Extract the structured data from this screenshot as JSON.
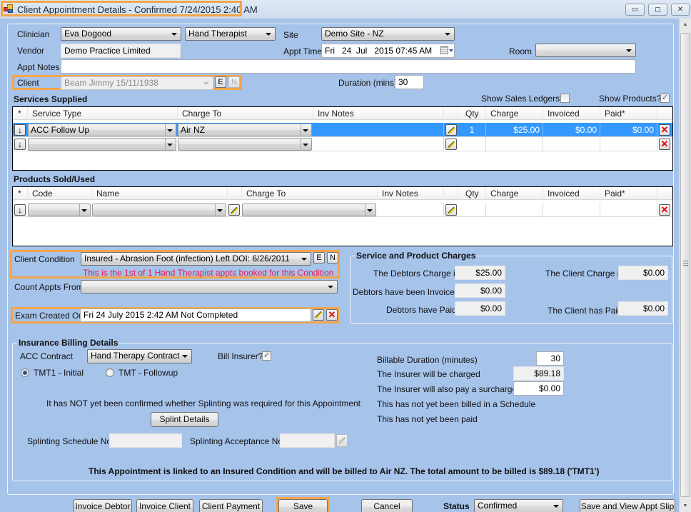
{
  "window": {
    "title": "Client Appointment Details - Confirmed 7/24/2015 2:40 AM",
    "icon": "app-window-icon",
    "controls": {
      "minimize": "▭",
      "maximize": "◻",
      "close": "✕"
    }
  },
  "appointment": {
    "clinician_label": "Clinician",
    "clinician_value": "Eva Dogood",
    "role_value": "Hand Therapist",
    "site_label": "Site",
    "site_value": "Demo Site - NZ",
    "vendor_label": "Vendor",
    "vendor_value": "Demo Practice Limited",
    "appt_time_label": "Appt Time",
    "appt_time_value": "Fri   24  Jul   2015 07:45 AM",
    "room_label": "Room",
    "room_value": "",
    "notes_label": "Appt Notes",
    "notes_value": "",
    "client_label": "Client",
    "client_value": "Beam Jimmy 15/11/1938",
    "client_edit_btn": "E",
    "client_new_btn": "N",
    "duration_label": "Duration (mins)",
    "duration_value": "30"
  },
  "services": {
    "title": "Services Supplied",
    "show_sales_ledgers_label": "Show Sales Ledgers?",
    "show_sales_ledgers_checked": false,
    "show_products_label": "Show Products?",
    "show_products_checked": true,
    "columns": [
      "*",
      "Service Type",
      "Charge To",
      "Inv Notes",
      "",
      "Qty",
      "Charge",
      "Invoiced",
      "Paid*",
      ""
    ],
    "rows": [
      {
        "service_type": "ACC Follow Up",
        "charge_to": "Air NZ",
        "inv_notes": "",
        "qty": "1",
        "charge": "$25.00",
        "invoiced": "$0.00",
        "paid": "$0.00",
        "selected": true
      },
      {
        "service_type": "",
        "charge_to": "",
        "inv_notes": "",
        "qty": "",
        "charge": "",
        "invoiced": "",
        "paid": "",
        "selected": false
      }
    ]
  },
  "products": {
    "title": "Products Sold/Used",
    "columns": [
      "*",
      "Code",
      "Name",
      "",
      "Charge To",
      "Inv Notes",
      "",
      "Qty",
      "Charge",
      "Invoiced",
      "Paid*",
      ""
    ],
    "rows": [
      {
        "code": "",
        "name": "",
        "charge_to": "",
        "inv_notes": "",
        "qty": "",
        "charge": "",
        "invoiced": "",
        "paid": ""
      }
    ]
  },
  "condition": {
    "label": "Client Condition",
    "value": "Insured -  Abrasion Foot (infection) Left DOI: 6/26/2011",
    "edit_btn": "E",
    "new_btn": "N",
    "note": "This is the 1st of 1 Hand Therapist appts booked for this Condition",
    "count_from_label": "Count Appts From",
    "count_from_value": "",
    "exam_label": "Exam Created On",
    "exam_value": "Fri 24 July 2015 2:42 AM Not Completed"
  },
  "charges": {
    "title": "Service and Product Charges",
    "debtors_charge_label": "The Debtors Charge is",
    "debtors_charge_value": "$25.00",
    "client_charge_label": "The Client Charge is",
    "client_charge_value": "$0.00",
    "debtors_invoiced_label": "Debtors have been Invoiced",
    "debtors_invoiced_value": "$0.00",
    "debtors_paid_label": "Debtors have Paid",
    "debtors_paid_value": "$0.00",
    "client_paid_label": "The Client has Paid",
    "client_paid_value": "$0.00"
  },
  "insurance": {
    "title": "Insurance Billing Details",
    "acc_contract_label": "ACC Contract",
    "acc_contract_value": "Hand Therapy Contract",
    "bill_insurer_label": "Bill Insurer?",
    "bill_insurer_checked": true,
    "radio_initial_label": "TMT1 - Initial",
    "radio_initial_selected": true,
    "radio_followup_label": "TMT - Followup",
    "radio_followup_selected": false,
    "splint_note": "It has NOT yet been confirmed whether Splinting was required for this Appointment",
    "splint_btn": "Splint Details",
    "splint_schedule_label": "Splinting Schedule No",
    "splint_schedule_value": "",
    "splint_acceptance_label": "Splinting Acceptance No",
    "splint_acceptance_value": "",
    "billable_duration_label": "Billable Duration (minutes)",
    "billable_duration_value": "30",
    "insurer_charged_label": "The Insurer will be charged",
    "insurer_charged_value": "$89.18",
    "surcharge_label": "The Insurer will also pay a surcharge of",
    "surcharge_value": "$0.00",
    "schedule_status": "This has not yet been billed in a Schedule",
    "paid_status": "This has not yet been paid",
    "summary": "This Appointment is linked to an Insured Condition and will be billed to Air NZ. The total amount to be billed is $89.18 ('TMT1')"
  },
  "footer": {
    "invoice_debtor": "Invoice Debtor",
    "invoice_client": "Invoice Client",
    "client_payment": "Client Payment",
    "save": "Save",
    "cancel": "Cancel",
    "status_label": "Status",
    "status_value": "Confirmed",
    "save_view_slip": "Save and View Appt Slip"
  },
  "colors": {
    "panel_bg": "#a6c3ea",
    "highlight": "#f5a54a",
    "selected_row": "#3399ff",
    "note_red": "#e8174a",
    "delete_red": "#e00000"
  }
}
